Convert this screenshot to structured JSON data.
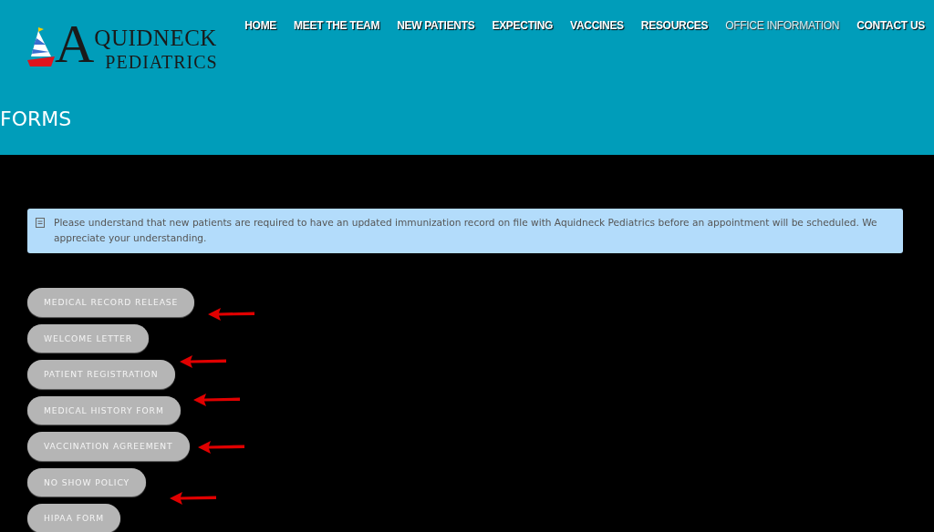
{
  "logo": {
    "initial": "A",
    "name": "QUIDNECK",
    "subtitle": "PEDIATRICS"
  },
  "nav": [
    {
      "label": "HOME",
      "selected": false
    },
    {
      "label": "MEET THE TEAM",
      "selected": false
    },
    {
      "label": "NEW PATIENTS",
      "selected": false
    },
    {
      "label": "EXPECTING",
      "selected": false
    },
    {
      "label": "VACCINES",
      "selected": false
    },
    {
      "label": "RESOURCES",
      "selected": false
    },
    {
      "label": "OFFICE INFORMATION",
      "selected": true
    },
    {
      "label": "CONTACT US",
      "selected": false
    }
  ],
  "page_title": "FORMS",
  "notice": "Please understand that new patients are required to have an updated immunization record on file with Aquidneck Pediatrics before an appointment will be scheduled. We appreciate your understanding.",
  "forms": [
    "MEDICAL RECORD RELEASE",
    "WELCOME LETTER",
    "PATIENT REGISTRATION",
    "MEDICAL HISTORY FORM",
    "VACCINATION AGREEMENT",
    "NO SHOW POLICY",
    "HIPAA FORM"
  ]
}
